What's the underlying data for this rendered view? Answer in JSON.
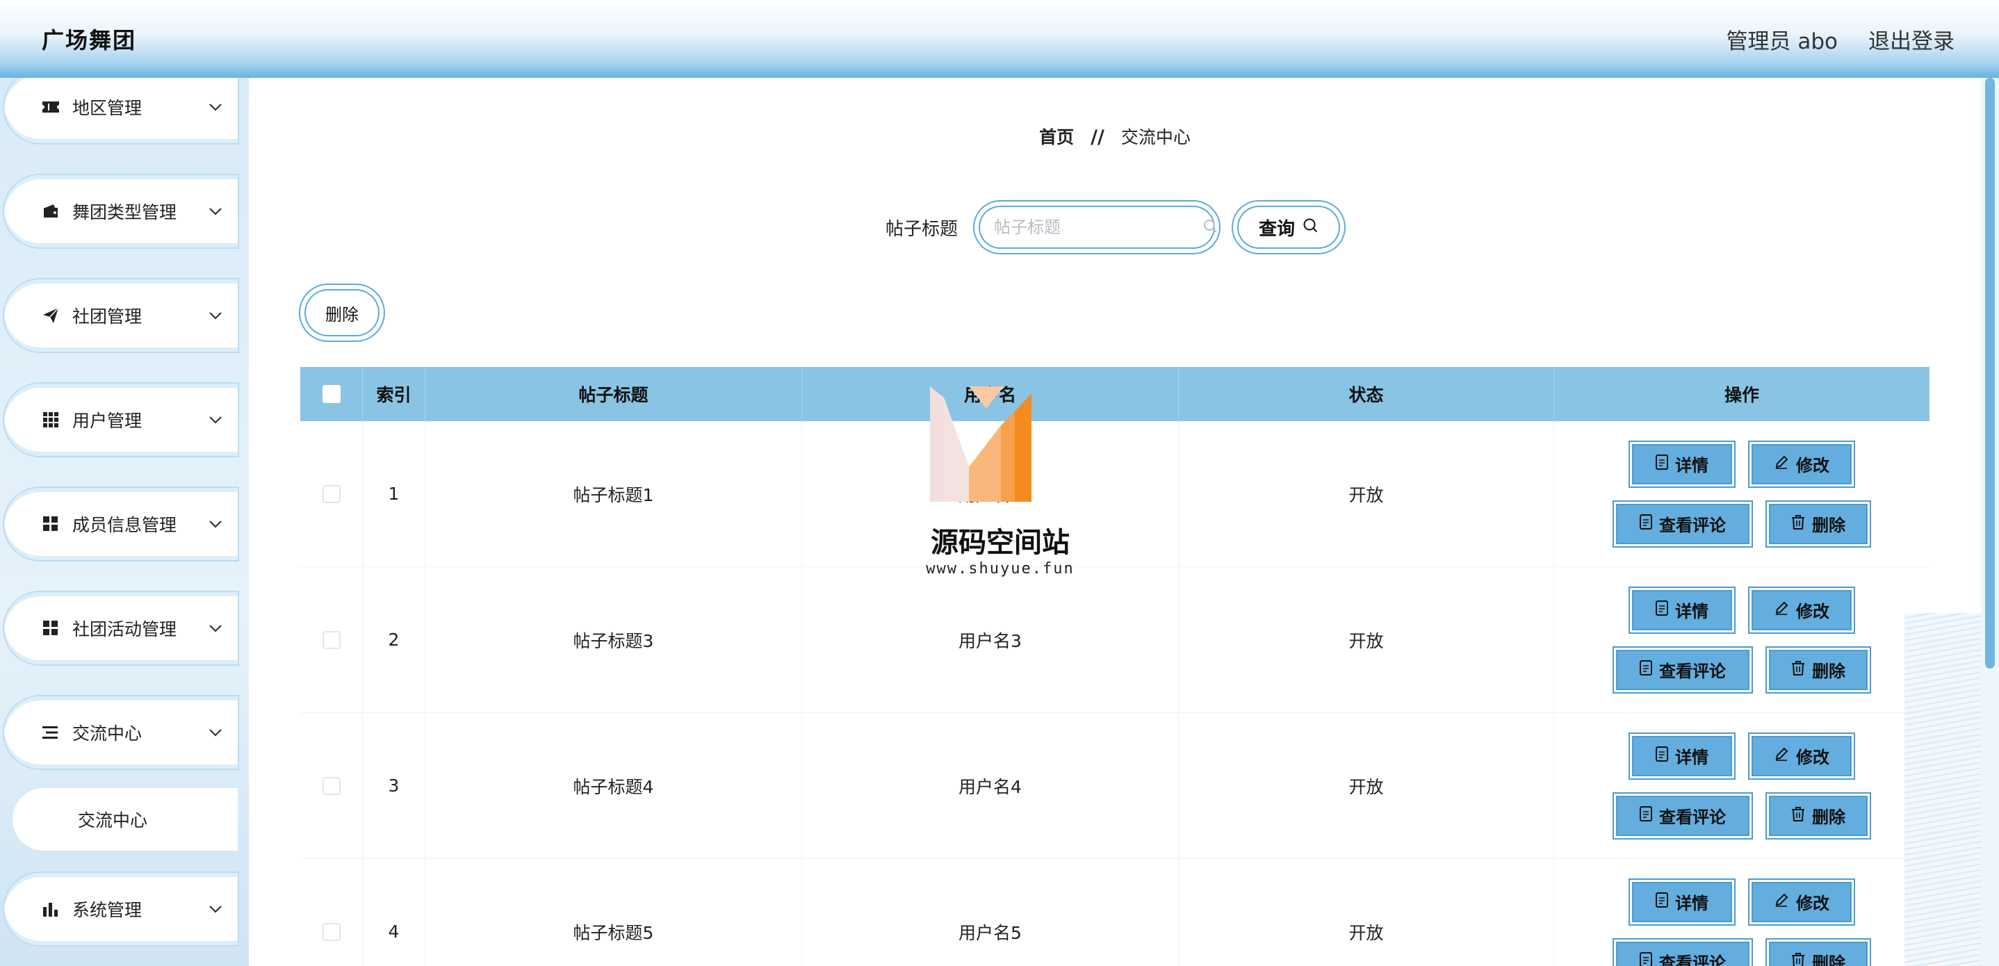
{
  "header": {
    "brand": "广场舞团",
    "admin": "管理员 abo",
    "logout": "退出登录"
  },
  "sidebar": {
    "items": [
      {
        "label": "地区管理",
        "icon": "ticket-icon"
      },
      {
        "label": "舞团类型管理",
        "icon": "wallet-icon"
      },
      {
        "label": "社团管理",
        "icon": "paper-plane-icon"
      },
      {
        "label": "用户管理",
        "icon": "grid-dots-icon"
      },
      {
        "label": "成员信息管理",
        "icon": "tiles-icon"
      },
      {
        "label": "社团活动管理",
        "icon": "tiles-icon"
      },
      {
        "label": "交流中心",
        "icon": "list-icon"
      },
      {
        "label": "系统管理",
        "icon": "bar-chart-icon"
      }
    ],
    "submenu": {
      "label": "交流中心"
    }
  },
  "breadcrumb": {
    "home": "首页",
    "separator": "//",
    "current": "交流中心"
  },
  "search": {
    "label": "帖子标题",
    "placeholder": "帖子标题",
    "value": "",
    "query_label": "查询"
  },
  "toolbar": {
    "delete_label": "删除"
  },
  "table": {
    "columns": [
      "索引",
      "帖子标题",
      "用户名",
      "状态",
      "操作"
    ],
    "rows": [
      {
        "index": "1",
        "title": "帖子标题1",
        "user": "用户名1",
        "status": "开放"
      },
      {
        "index": "2",
        "title": "帖子标题3",
        "user": "用户名3",
        "status": "开放"
      },
      {
        "index": "3",
        "title": "帖子标题4",
        "user": "用户名4",
        "status": "开放"
      },
      {
        "index": "4",
        "title": "帖子标题5",
        "user": "用户名5",
        "status": "开放"
      }
    ],
    "actions": {
      "detail": "详情",
      "edit": "修改",
      "comments": "查看评论",
      "delete": "删除"
    }
  },
  "watermark": {
    "name": "源码空间站",
    "url": "www.shuyue.fun"
  },
  "colors": {
    "accent": "#5aaadd",
    "table_header": "#8ac4e4",
    "button_fill": "#63aede"
  }
}
